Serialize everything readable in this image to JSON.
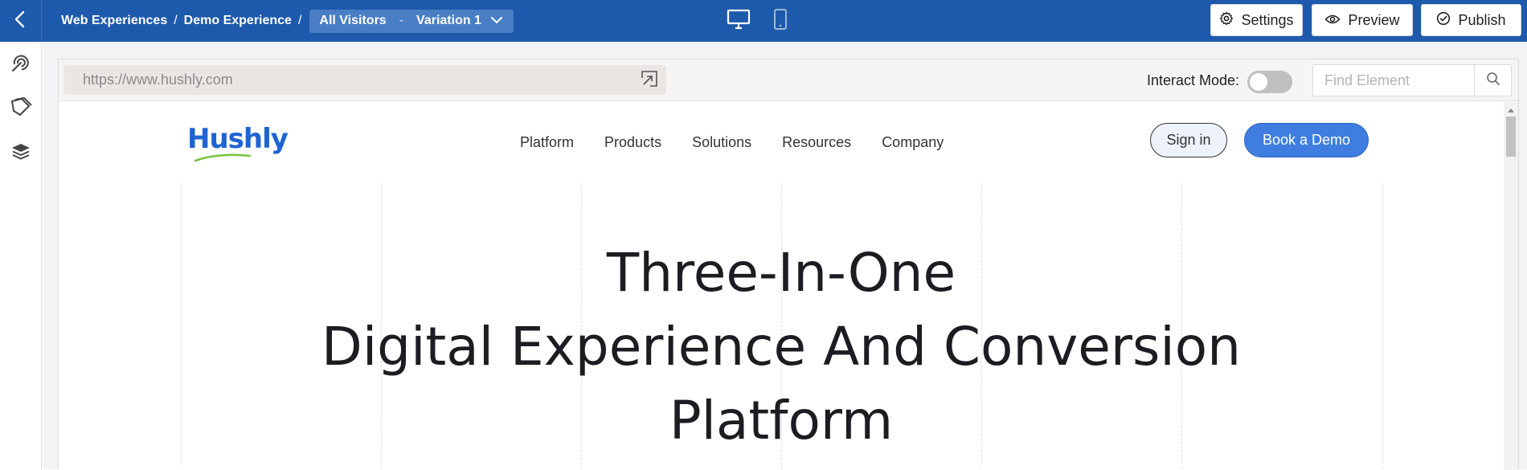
{
  "breadcrumb": {
    "items": [
      "Web Experiences",
      "Demo Experience"
    ],
    "separator": "/"
  },
  "variant": {
    "audience": "All Visitors",
    "dash": "-",
    "variation": "Variation 1"
  },
  "devices": [
    "desktop-icon",
    "mobile-icon"
  ],
  "actions": {
    "settings": "Settings",
    "preview": "Preview",
    "publish": "Publish"
  },
  "leftrail": [
    "targeting-icon",
    "tags-icon",
    "layers-icon"
  ],
  "urlbar": {
    "url": "https://www.hushly.com",
    "interact_label": "Interact Mode:",
    "interact_on": false,
    "find_placeholder": "Find Element"
  },
  "site": {
    "logo": "Hushly",
    "nav": [
      "Platform",
      "Products",
      "Solutions",
      "Resources",
      "Company"
    ],
    "signin": "Sign in",
    "demo": "Book a Demo",
    "hero": [
      "Three-In-One",
      "Digital Experience And Conversion",
      "Platform"
    ]
  },
  "colors": {
    "topbar": "#1d5aab",
    "accent": "#3f7ee0",
    "logo": "#1f63d3"
  }
}
